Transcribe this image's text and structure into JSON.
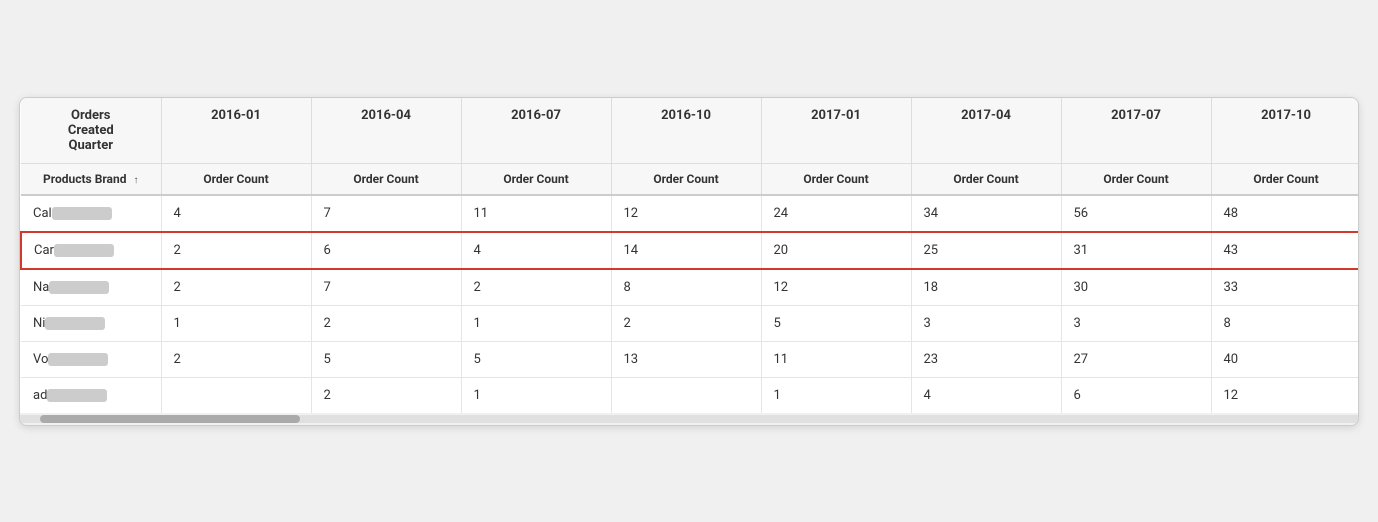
{
  "table": {
    "header_row1": {
      "col0": "Orders\nCreated\nQuarter",
      "col1": "2016-01",
      "col2": "2016-04",
      "col3": "2016-07",
      "col4": "2016-10",
      "col5": "2017-01",
      "col6": "2017-04",
      "col7": "2017-07",
      "col8": "2017-10"
    },
    "header_row2": {
      "col0": "Products Brand",
      "col0_sort": "↑",
      "col1": "Order Count",
      "col2": "Order Count",
      "col3": "Order Count",
      "col4": "Order Count",
      "col5": "Order Count",
      "col6": "Order Count",
      "col7": "Order Count",
      "col8": "Order Count"
    },
    "rows": [
      {
        "id": "row-cal",
        "brand": "Cal",
        "blurred": true,
        "highlighted": false,
        "values": [
          "4",
          "7",
          "11",
          "12",
          "24",
          "34",
          "56",
          "48"
        ]
      },
      {
        "id": "row-car",
        "brand": "Car",
        "blurred": true,
        "highlighted": true,
        "values": [
          "2",
          "6",
          "4",
          "14",
          "20",
          "25",
          "31",
          "43"
        ]
      },
      {
        "id": "row-na",
        "brand": "Na",
        "blurred": true,
        "highlighted": false,
        "values": [
          "2",
          "7",
          "2",
          "8",
          "12",
          "18",
          "30",
          "33"
        ]
      },
      {
        "id": "row-ni",
        "brand": "Ni",
        "blurred": true,
        "highlighted": false,
        "values": [
          "1",
          "2",
          "1",
          "2",
          "5",
          "3",
          "3",
          "8"
        ]
      },
      {
        "id": "row-vo",
        "brand": "Vo",
        "blurred": true,
        "highlighted": false,
        "values": [
          "2",
          "5",
          "5",
          "13",
          "11",
          "23",
          "27",
          "40"
        ]
      },
      {
        "id": "row-ad",
        "brand": "ad",
        "blurred": true,
        "highlighted": false,
        "values": [
          "",
          "2",
          "1",
          "",
          "1",
          "4",
          "6",
          "12"
        ]
      }
    ]
  }
}
